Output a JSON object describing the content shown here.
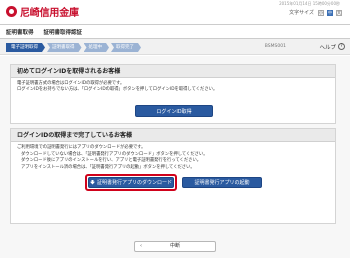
{
  "header": {
    "brand": "尼崎信用金庫",
    "datetime": "2015年01月14日 15時00分00秒",
    "font_size_label": "文字サイズ",
    "font_sizes": [
      "小",
      "中",
      "大"
    ],
    "font_size_selected": "中",
    "accent_color": "#c8102e"
  },
  "nav": {
    "items": [
      "証明書取得",
      "証明書取得認証"
    ]
  },
  "steps": {
    "items": [
      "電子証明取得",
      "証明書取得",
      "処理中",
      "取得完了"
    ],
    "active_index": 0,
    "screen_id": "BSMS001",
    "help_label": "ヘルプ",
    "help_icon": "question-icon"
  },
  "first_login": {
    "title": "初めてログインIDを取得されるお客様",
    "lines": [
      "電子証明書方式の場合はログインIDの取得が必要です。",
      "ログインIDをお持ちでない方は、「ログインIDの取得」ボタンを押してログインIDを取得してください。"
    ],
    "button_label": "ログインID取得"
  },
  "completed": {
    "title": "ログインIDの取得まで完了しているお客様",
    "lines": [
      "ご利用環境での証明書発行にはアプリのダウンロードが必要です。",
      "ダウンロードしていない場合は、「証明書発行アプリのダウンロード」ボタンを押してください。",
      "ダウンロード後にアプリのインストールを行い、アプリと電子証明書発行を行ってください。",
      "アプリをインストール済の場合は、「証明書発行アプリの起動」ボタンを押してください。"
    ],
    "download_button": "証明書発行アプリのダウンロード",
    "download_icon": "download-icon",
    "launch_button": "証明書発行アプリの起動",
    "highlight_color": "#d0021b"
  },
  "footer": {
    "cancel_label": "中断",
    "cancel_icon": "chevron-left-icon"
  }
}
